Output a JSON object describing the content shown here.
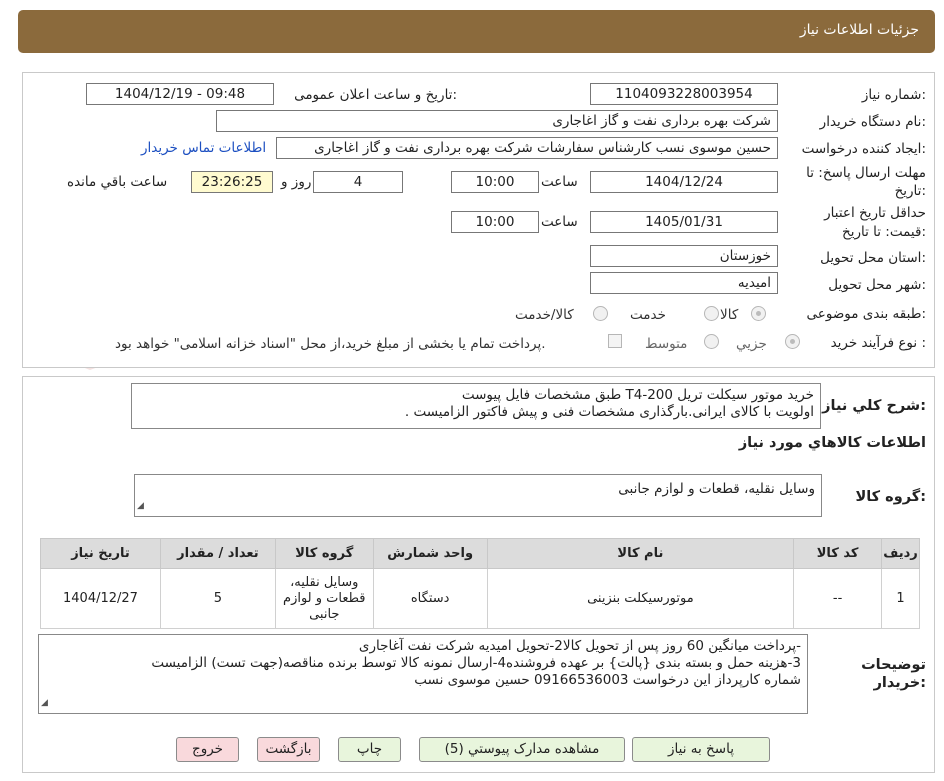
{
  "header": {
    "title": "جزئیات اطلاعات نیاز"
  },
  "form": {
    "need_number_label": "شماره نیاز:",
    "need_number": "1104093228003954",
    "announce_label": "تاریخ و ساعت اعلان عمومی:",
    "announce_value": "1404/12/19 - 09:48",
    "buyer_org_label": "نام دستگاه خریدار:",
    "buyer_org": "شرکت بهره برداری نفت و گاز اغاجاری",
    "requester_label": "ایجاد کننده درخواست:",
    "requester": "حسین موسوی نسب کارشناس سفارشات شرکت بهره برداری نفت و گاز اغاجاری",
    "contact_link": "اطلاعات تماس خریدار",
    "deadline_label_1": "مهلت ارسال پاسخ: تا",
    "deadline_label_2": "تاریخ:",
    "deadline_date": "1404/12/24",
    "time_label": "ساعت",
    "deadline_time": "10:00",
    "days": "4",
    "days_label": "روز و",
    "remaining_time": "23:26:25",
    "remaining_label": "ساعت باقي مانده",
    "validity_label_1": "حداقل تاریخ اعتبار",
    "validity_label_2": "قیمت: تا تاریخ:",
    "validity_date": "1405/01/31",
    "validity_time": "10:00",
    "province_label": "استان محل تحویل:",
    "province": "خوزستان",
    "city_label": "شهر محل تحویل:",
    "city": "امیدیه",
    "category_label": "طبقه بندی موضوعی:",
    "category_options": [
      "کالا",
      "خدمت",
      "کالا/خدمت"
    ],
    "process_label": "نوع فرآیند خرید :",
    "process_options": [
      "جزیي",
      "متوسط"
    ],
    "payment_note": "پرداخت تمام یا بخشی از مبلغ خرید،از محل \"اسناد خزانه اسلامی\" خواهد بود."
  },
  "summary": {
    "label": "شرح کلي نياز:",
    "line1": "خرید  موتور سیکلت تریل T4-200  طبق مشخصات فایل پیوست",
    "line2": "اولویت با کالای ایرانی.بارگذاری مشخصات فنی و پیش فاکتور الزامیست ."
  },
  "goods": {
    "section_title": "اطلاعات کالاهاي مورد نياز",
    "group_label": "گروه کالا:",
    "group_value": "وسایل نقلیه، قطعات و لوازم جانبی"
  },
  "table": {
    "headers": [
      "رديف",
      "کد کالا",
      "نام کالا",
      "واحد شمارش",
      "گروه کالا",
      "تعداد / مقدار",
      "تاریخ نیاز"
    ],
    "rows": [
      {
        "row": "1",
        "code": "--",
        "name": "موتورسیکلت بنزینی",
        "unit": "دستگاه",
        "group_l1": "وسایل نقلیه،",
        "group_l2": "قطعات و لوازم",
        "group_l3": "جانبی",
        "qty": "5",
        "date": "1404/12/27"
      }
    ]
  },
  "notes": {
    "label_1": "توضیحات",
    "label_2": "خریدار:",
    "line1": "-پرداخت میانگین 60 روز پس از تحویل کالا2-تحویل امیدیه شرکت نفت آغاجاری",
    "line2": "3-هزینه حمل  و بسته بندی {پالت} بر عهده فروشنده4-ارسال نمونه کالا توسط برنده مناقصه(جهت تست) الزامیست",
    "line3": "شماره کارپرداز این درخواست 09166536003 حسین موسوی نسب"
  },
  "buttons": {
    "reply": "پاسخ به نیاز",
    "view_docs": "مشاهده مدارک پیوستي (5)",
    "print": "چاپ",
    "back": "بازگشت",
    "exit": "خروج"
  },
  "watermark": {
    "text": "AriaTender.net"
  }
}
